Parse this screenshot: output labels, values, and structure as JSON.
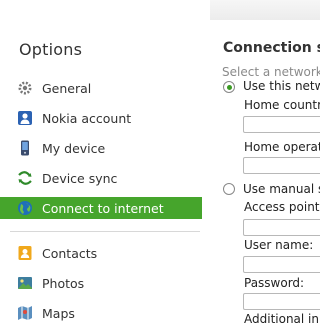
{
  "sidebar": {
    "title": "Options",
    "items": [
      {
        "label": "General",
        "icon": "gear-icon"
      },
      {
        "label": "Nokia account",
        "icon": "user-icon"
      },
      {
        "label": "My device",
        "icon": "phone-icon"
      },
      {
        "label": "Device sync",
        "icon": "sync-icon"
      },
      {
        "label": "Connect to internet",
        "icon": "globe-icon"
      },
      {
        "label": "Contacts",
        "icon": "contacts-icon"
      },
      {
        "label": "Photos",
        "icon": "photos-icon"
      },
      {
        "label": "Maps",
        "icon": "maps-icon"
      }
    ],
    "selected_index": 4
  },
  "content": {
    "heading": "Connection se",
    "hint": "Select a network",
    "option_network": "Use this netw",
    "home_country_label": "Home country",
    "home_operator_label": "Home operato",
    "option_manual": "Use manual s",
    "access_point_label": "Access point:",
    "user_name_label": "User name:",
    "password_label": "Password:",
    "additional_label": "Additional initi"
  },
  "colors": {
    "accent": "#46a52c"
  }
}
